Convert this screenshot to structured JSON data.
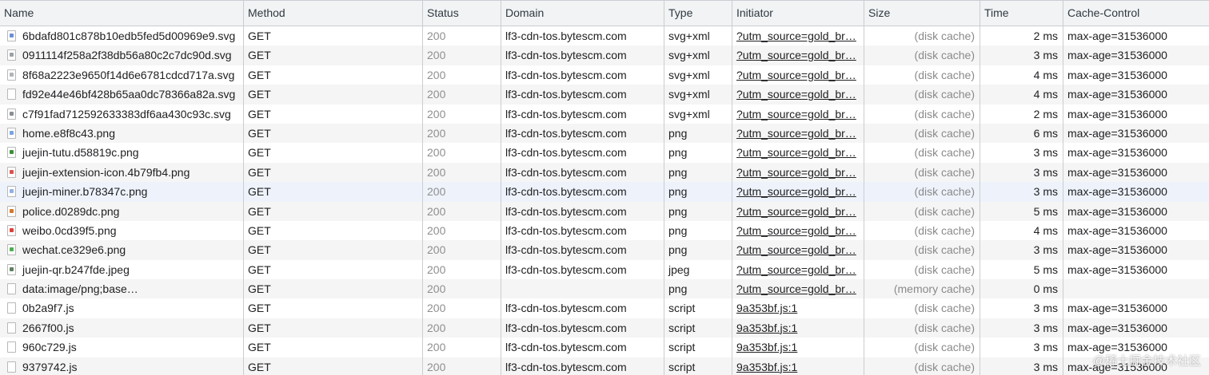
{
  "columns": [
    "Name",
    "Method",
    "Status",
    "Domain",
    "Type",
    "Initiator",
    "Size",
    "Time",
    "Cache-Control"
  ],
  "rows": [
    {
      "name": "6bdafd801c878b10edb5fed5d00969e9.svg",
      "method": "GET",
      "status": "200",
      "domain": "lf3-cdn-tos.bytescm.com",
      "type": "svg+xml",
      "initiator": "?utm_source=gold_br…",
      "size": "(disk cache)",
      "time": "2 ms",
      "cache": "max-age=31536000",
      "icon": "svg-file-icon",
      "icon_color": "#6b8fd6"
    },
    {
      "name": "0911114f258a2f38db56a80c2c7dc90d.svg",
      "method": "GET",
      "status": "200",
      "domain": "lf3-cdn-tos.bytescm.com",
      "type": "svg+xml",
      "initiator": "?utm_source=gold_br…",
      "size": "(disk cache)",
      "time": "3 ms",
      "cache": "max-age=31536000",
      "icon": "svg-file-icon",
      "icon_color": "#9aa0a6"
    },
    {
      "name": "8f68a2223e9650f14d6e6781cdcd717a.svg",
      "method": "GET",
      "status": "200",
      "domain": "lf3-cdn-tos.bytescm.com",
      "type": "svg+xml",
      "initiator": "?utm_source=gold_br…",
      "size": "(disk cache)",
      "time": "4 ms",
      "cache": "max-age=31536000",
      "icon": "svg-file-icon",
      "icon_color": "#b0b4b8"
    },
    {
      "name": "fd92e44e46bf428b65aa0dc78366a82a.svg",
      "method": "GET",
      "status": "200",
      "domain": "lf3-cdn-tos.bytescm.com",
      "type": "svg+xml",
      "initiator": "?utm_source=gold_br…",
      "size": "(disk cache)",
      "time": "4 ms",
      "cache": "max-age=31536000",
      "icon": "svg-file-icon",
      "icon_color": "#ffffff"
    },
    {
      "name": "c7f91fad712592633383df6aa430c93c.svg",
      "method": "GET",
      "status": "200",
      "domain": "lf3-cdn-tos.bytescm.com",
      "type": "svg+xml",
      "initiator": "?utm_source=gold_br…",
      "size": "(disk cache)",
      "time": "2 ms",
      "cache": "max-age=31536000",
      "icon": "svg-file-icon",
      "icon_color": "#8a8e92"
    },
    {
      "name": "home.e8f8c43.png",
      "method": "GET",
      "status": "200",
      "domain": "lf3-cdn-tos.bytescm.com",
      "type": "png",
      "initiator": "?utm_source=gold_br…",
      "size": "(disk cache)",
      "time": "6 ms",
      "cache": "max-age=31536000",
      "icon": "image-file-icon",
      "icon_color": "#7aa3e0"
    },
    {
      "name": "juejin-tutu.d58819c.png",
      "method": "GET",
      "status": "200",
      "domain": "lf3-cdn-tos.bytescm.com",
      "type": "png",
      "initiator": "?utm_source=gold_br…",
      "size": "(disk cache)",
      "time": "3 ms",
      "cache": "max-age=31536000",
      "icon": "image-file-icon",
      "icon_color": "#3d8f3a"
    },
    {
      "name": "juejin-extension-icon.4b79fb4.png",
      "method": "GET",
      "status": "200",
      "domain": "lf3-cdn-tos.bytescm.com",
      "type": "png",
      "initiator": "?utm_source=gold_br…",
      "size": "(disk cache)",
      "time": "3 ms",
      "cache": "max-age=31536000",
      "icon": "image-file-icon",
      "icon_color": "#d9534f"
    },
    {
      "name": "juejin-miner.b78347c.png",
      "method": "GET",
      "status": "200",
      "domain": "lf3-cdn-tos.bytescm.com",
      "type": "png",
      "initiator": "?utm_source=gold_br…",
      "size": "(disk cache)",
      "time": "3 ms",
      "cache": "max-age=31536000",
      "icon": "image-file-icon",
      "icon_color": "#8fb0e6"
    },
    {
      "name": "police.d0289dc.png",
      "method": "GET",
      "status": "200",
      "domain": "lf3-cdn-tos.bytescm.com",
      "type": "png",
      "initiator": "?utm_source=gold_br…",
      "size": "(disk cache)",
      "time": "5 ms",
      "cache": "max-age=31536000",
      "icon": "image-file-icon",
      "icon_color": "#d4782a"
    },
    {
      "name": "weibo.0cd39f5.png",
      "method": "GET",
      "status": "200",
      "domain": "lf3-cdn-tos.bytescm.com",
      "type": "png",
      "initiator": "?utm_source=gold_br…",
      "size": "(disk cache)",
      "time": "4 ms",
      "cache": "max-age=31536000",
      "icon": "image-file-icon",
      "icon_color": "#e0403a"
    },
    {
      "name": "wechat.ce329e6.png",
      "method": "GET",
      "status": "200",
      "domain": "lf3-cdn-tos.bytescm.com",
      "type": "png",
      "initiator": "?utm_source=gold_br…",
      "size": "(disk cache)",
      "time": "3 ms",
      "cache": "max-age=31536000",
      "icon": "image-file-icon",
      "icon_color": "#4caf50"
    },
    {
      "name": "juejin-qr.b247fde.jpeg",
      "method": "GET",
      "status": "200",
      "domain": "lf3-cdn-tos.bytescm.com",
      "type": "jpeg",
      "initiator": "?utm_source=gold_br…",
      "size": "(disk cache)",
      "time": "5 ms",
      "cache": "max-age=31536000",
      "icon": "image-file-icon",
      "icon_color": "#5f7f5f"
    },
    {
      "name": "data:image/png;base…",
      "method": "GET",
      "status": "200",
      "domain": "",
      "type": "png",
      "initiator": "?utm_source=gold_br…",
      "size": "(memory cache)",
      "time": "0 ms",
      "cache": "",
      "icon": "document-file-icon",
      "icon_color": "#ffffff"
    },
    {
      "name": "0b2a9f7.js",
      "method": "GET",
      "status": "200",
      "domain": "lf3-cdn-tos.bytescm.com",
      "type": "script",
      "initiator": "9a353bf.js:1",
      "size": "(disk cache)",
      "time": "3 ms",
      "cache": "max-age=31536000",
      "icon": "script-file-icon",
      "icon_color": "#ffffff"
    },
    {
      "name": "2667f00.js",
      "method": "GET",
      "status": "200",
      "domain": "lf3-cdn-tos.bytescm.com",
      "type": "script",
      "initiator": "9a353bf.js:1",
      "size": "(disk cache)",
      "time": "3 ms",
      "cache": "max-age=31536000",
      "icon": "script-file-icon",
      "icon_color": "#ffffff"
    },
    {
      "name": "960c729.js",
      "method": "GET",
      "status": "200",
      "domain": "lf3-cdn-tos.bytescm.com",
      "type": "script",
      "initiator": "9a353bf.js:1",
      "size": "(disk cache)",
      "time": "3 ms",
      "cache": "max-age=31536000",
      "icon": "script-file-icon",
      "icon_color": "#ffffff"
    },
    {
      "name": "9379742.js",
      "method": "GET",
      "status": "200",
      "domain": "lf3-cdn-tos.bytescm.com",
      "type": "script",
      "initiator": "9a353bf.js:1",
      "size": "(disk cache)",
      "time": "3 ms",
      "cache": "max-age=31536000",
      "icon": "script-file-icon",
      "icon_color": "#ffffff"
    }
  ],
  "watermark": "@稀土掘金技术社区"
}
